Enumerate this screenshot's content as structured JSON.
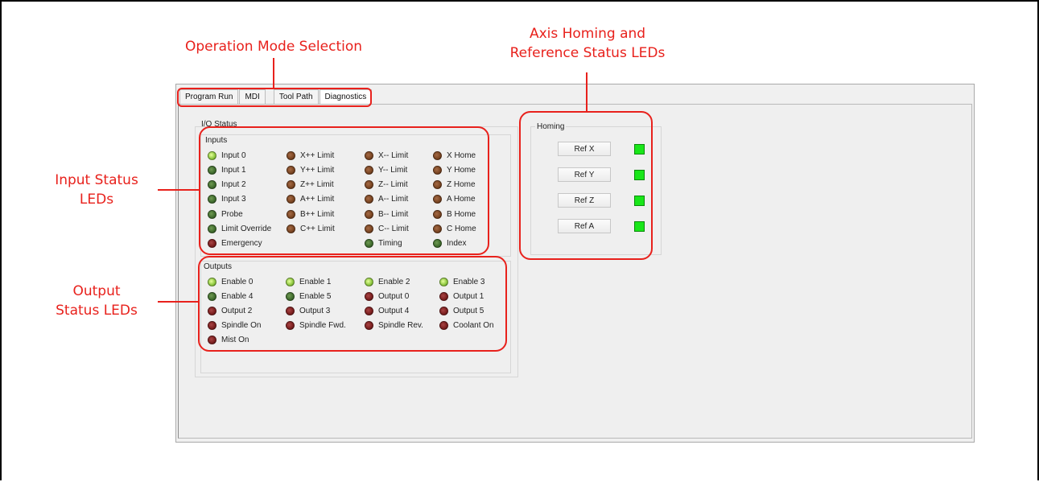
{
  "callouts": {
    "mode": "Operation Mode Selection",
    "homing_line1": "Axis Homing and",
    "homing_line2": "Reference Status LEDs",
    "input_line1": "Input Status",
    "input_line2": "LEDs",
    "output_line1": "Output",
    "output_line2": "Status LEDs"
  },
  "tabs": [
    "Program Run",
    "MDI",
    "Tool Path",
    "Diagnostics"
  ],
  "active_tab": "Diagnostics",
  "io_status": {
    "title": "I/O Status",
    "inputs_title": "Inputs",
    "inputs": [
      {
        "label": "Input 0",
        "state": "lime"
      },
      {
        "label": "Input 1",
        "state": "green"
      },
      {
        "label": "Input 2",
        "state": "green"
      },
      {
        "label": "Input 3",
        "state": "green"
      },
      {
        "label": "Probe",
        "state": "green"
      },
      {
        "label": "Limit Override",
        "state": "green"
      },
      {
        "label": "Emergency",
        "state": "red"
      },
      {
        "label": "X++ Limit",
        "state": "brown"
      },
      {
        "label": "Y++ Limit",
        "state": "brown"
      },
      {
        "label": "Z++ Limit",
        "state": "brown"
      },
      {
        "label": "A++ Limit",
        "state": "brown"
      },
      {
        "label": "B++ Limit",
        "state": "brown"
      },
      {
        "label": "C++ Limit",
        "state": "brown"
      },
      {
        "label": "X-- Limit",
        "state": "brown"
      },
      {
        "label": "Y-- Limit",
        "state": "brown"
      },
      {
        "label": "Z-- Limit",
        "state": "brown"
      },
      {
        "label": "A-- Limit",
        "state": "brown"
      },
      {
        "label": "B-- Limit",
        "state": "brown"
      },
      {
        "label": "C-- Limit",
        "state": "brown"
      },
      {
        "label": "Timing",
        "state": "green"
      },
      {
        "label": "X Home",
        "state": "brown"
      },
      {
        "label": "Y Home",
        "state": "brown"
      },
      {
        "label": "Z Home",
        "state": "brown"
      },
      {
        "label": "A Home",
        "state": "brown"
      },
      {
        "label": "B Home",
        "state": "brown"
      },
      {
        "label": "C Home",
        "state": "brown"
      },
      {
        "label": "Index",
        "state": "green"
      }
    ],
    "outputs_title": "Outputs",
    "outputs": [
      {
        "label": "Enable 0",
        "state": "lime"
      },
      {
        "label": "Enable 4",
        "state": "green"
      },
      {
        "label": "Output 2",
        "state": "red"
      },
      {
        "label": "Spindle On",
        "state": "red"
      },
      {
        "label": "Mist On",
        "state": "red"
      },
      {
        "label": "Enable 1",
        "state": "lime"
      },
      {
        "label": "Enable 5",
        "state": "green"
      },
      {
        "label": "Output 3",
        "state": "red"
      },
      {
        "label": "Spindle Fwd.",
        "state": "red"
      },
      {
        "label": "Enable 2",
        "state": "lime"
      },
      {
        "label": "Output 0",
        "state": "red"
      },
      {
        "label": "Output 4",
        "state": "red"
      },
      {
        "label": "Spindle Rev.",
        "state": "red"
      },
      {
        "label": "Enable 3",
        "state": "lime"
      },
      {
        "label": "Output 1",
        "state": "red"
      },
      {
        "label": "Output 5",
        "state": "red"
      },
      {
        "label": "Coolant On",
        "state": "red"
      }
    ]
  },
  "homing": {
    "title": "Homing",
    "buttons": [
      "Ref X",
      "Ref Y",
      "Ref Z",
      "Ref A"
    ],
    "led_color": "#19e619"
  },
  "colors": {
    "callout": "#e8211c",
    "led_lime": "#8cc63f",
    "led_green": "#3f6b2d",
    "led_brown": "#7a4522",
    "led_red": "#7b1f1f"
  }
}
